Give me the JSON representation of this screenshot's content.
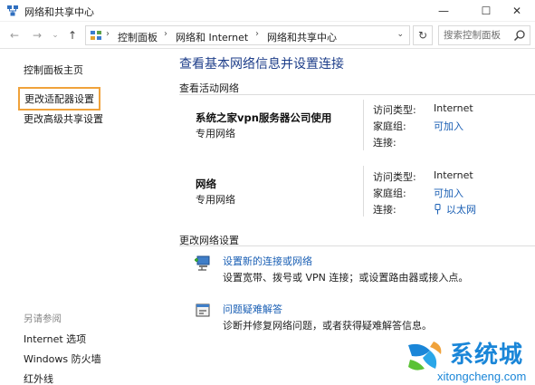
{
  "window": {
    "title": "网络和共享中心",
    "minimize_glyph": "—",
    "maximize_glyph": "☐",
    "close_glyph": "✕"
  },
  "navbar": {
    "back_glyph": "←",
    "forward_glyph": "→",
    "recent_glyph": "⌄",
    "up_glyph": "↑",
    "breadcrumbs": [
      "控制面板",
      "网络和 Internet",
      "网络和共享中心"
    ],
    "breadcrumb_separator": "›",
    "dropdown_glyph": "⌄",
    "refresh_glyph": "↻",
    "search_placeholder": "搜索控制面板"
  },
  "sidebar": {
    "links": [
      {
        "label": "控制面板主页"
      },
      {
        "label": "更改适配器设置",
        "highlighted": true
      },
      {
        "label": "更改高级共享设置"
      }
    ],
    "see_also_heading": "另请参阅",
    "see_also": [
      {
        "label": "Internet 选项"
      },
      {
        "label": "Windows 防火墙"
      },
      {
        "label": "红外线"
      }
    ]
  },
  "main": {
    "title": "查看基本网络信息并设置连接",
    "active_networks_label": "查看活动网络",
    "networks": [
      {
        "name": "系统之家vpn服务器公司使用",
        "type": "专用网络",
        "access_type_key": "访问类型:",
        "access_type_value": "Internet",
        "homegroup_key": "家庭组:",
        "homegroup_value": "可加入",
        "connection_key": "连接:",
        "connection_value": ""
      },
      {
        "name": "网络",
        "type": "专用网络",
        "access_type_key": "访问类型:",
        "access_type_value": "Internet",
        "homegroup_key": "家庭组:",
        "homegroup_value": "可加入",
        "connection_key": "连接:",
        "connection_value": "以太网"
      }
    ],
    "change_settings_label": "更改网络设置",
    "tasks": [
      {
        "icon": "new-connection-icon",
        "title": "设置新的连接或网络",
        "description": "设置宽带、拨号或 VPN 连接；或设置路由器或接入点。"
      },
      {
        "icon": "troubleshoot-icon",
        "title": "问题疑难解答",
        "description": "诊断并修复网络问题，或者获得疑难解答信息。"
      }
    ]
  },
  "watermark": {
    "name": "系统城",
    "url": "xitongcheng.com"
  },
  "colors": {
    "link": "#1a5fb4",
    "title": "#1e3e8a",
    "highlight_border": "#f0a23b",
    "watermark": "#1a86d8"
  }
}
